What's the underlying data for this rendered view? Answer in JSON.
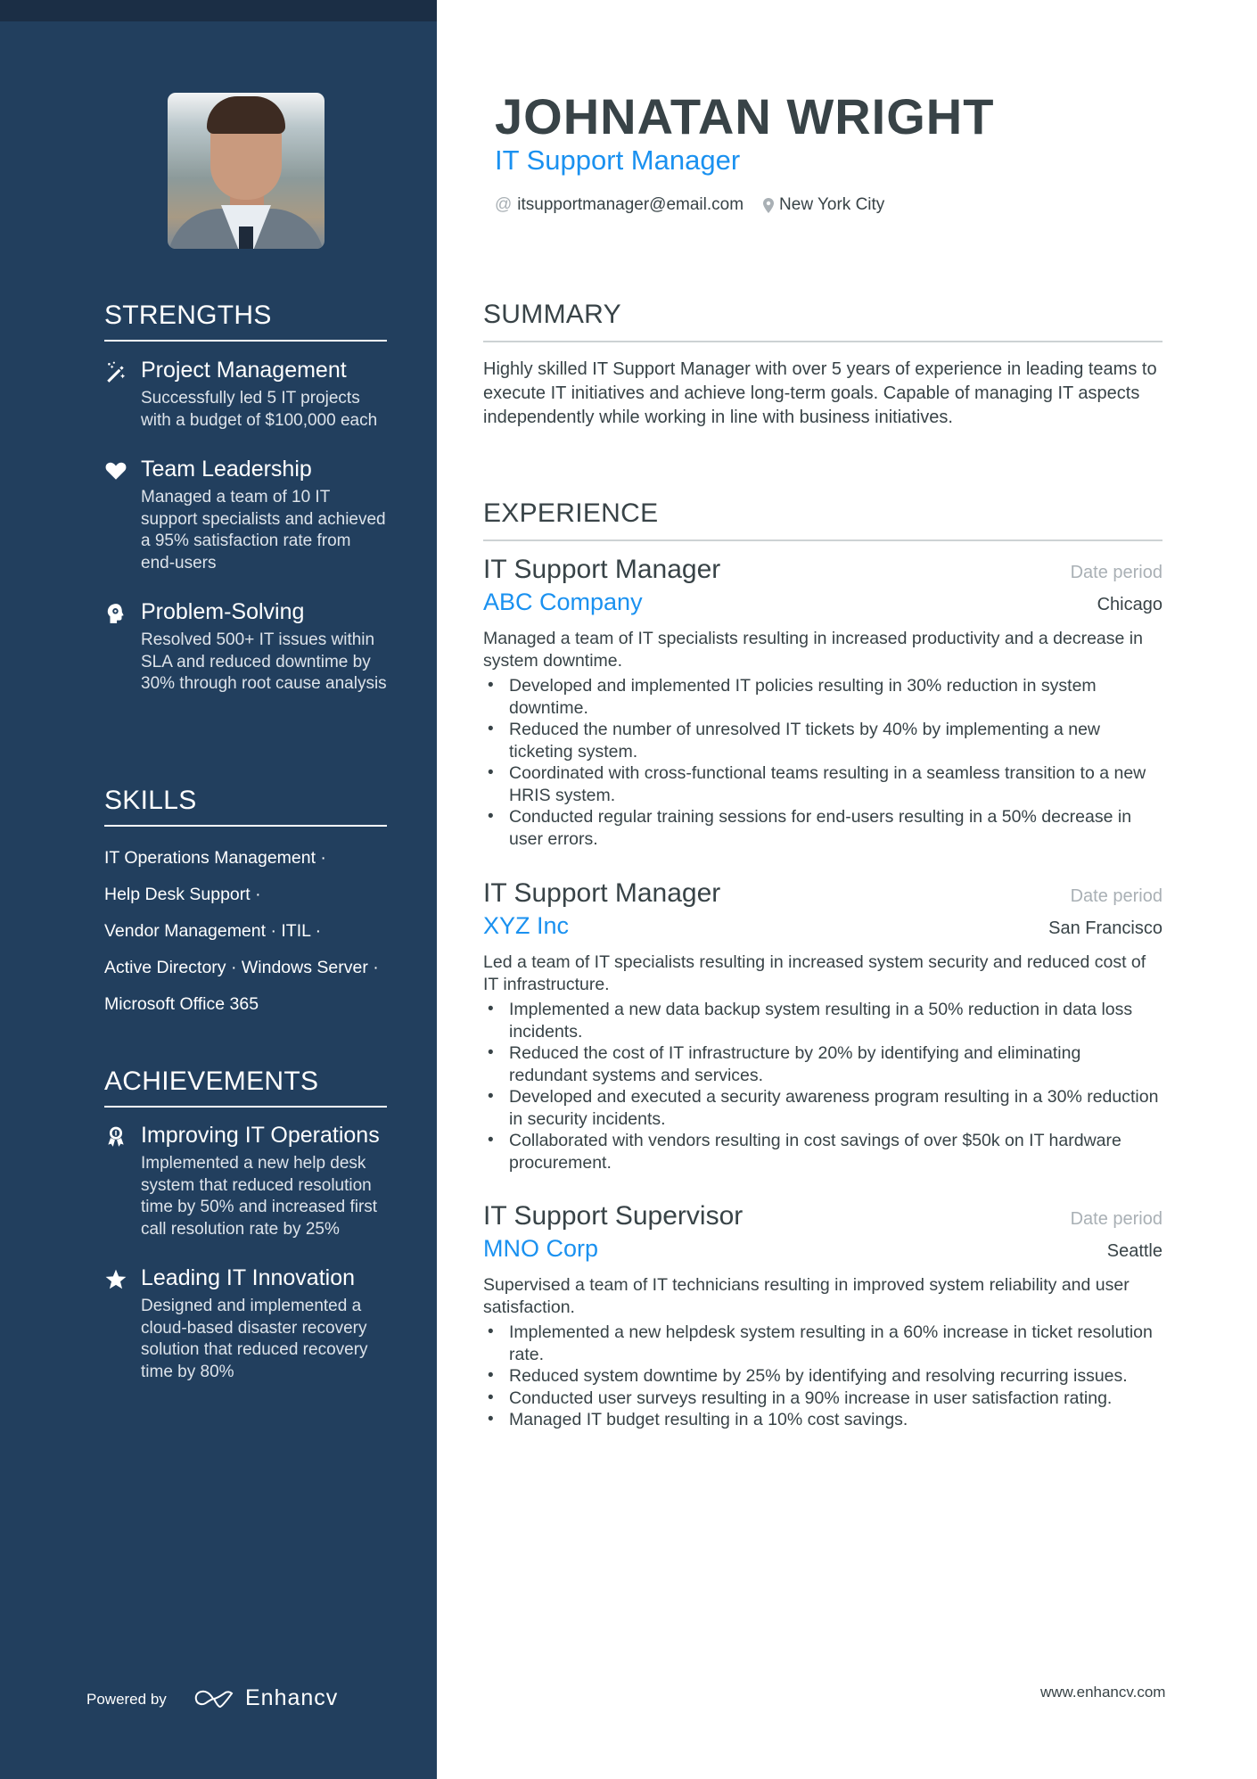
{
  "header": {
    "name": "JOHNATAN WRIGHT",
    "title": "IT Support Manager",
    "email": "itsupportmanager@email.com",
    "location": "New York City",
    "email_icon": "at-icon",
    "location_icon": "map-pin-icon"
  },
  "sidebar": {
    "strengths": {
      "heading": "STRENGTHS",
      "items": [
        {
          "icon": "magic-wand-icon",
          "title": "Project Management",
          "desc": "Successfully led 5 IT projects with a budget of $100,000 each"
        },
        {
          "icon": "heart-icon",
          "title": "Team Leadership",
          "desc": "Managed a team of 10 IT support specialists and achieved a 95% satisfaction rate from end-users"
        },
        {
          "icon": "brain-head-icon",
          "title": "Problem-Solving",
          "desc": "Resolved 500+ IT issues within SLA and reduced downtime by 30% through root cause analysis"
        }
      ]
    },
    "skills": {
      "heading": "SKILLS",
      "lines": [
        "IT Operations Management ·",
        "Help Desk Support ·",
        "Vendor Management · ITIL ·",
        "Active Directory · Windows Server ·",
        "Microsoft Office 365"
      ]
    },
    "achievements": {
      "heading": "ACHIEVEMENTS",
      "items": [
        {
          "icon": "award-ribbon-icon",
          "title": "Improving IT Operations",
          "desc": "Implemented a new help desk system that reduced resolution time by 50% and increased first call resolution rate by 25%"
        },
        {
          "icon": "star-icon",
          "title": "Leading IT Innovation",
          "desc": "Designed and implemented a cloud-based disaster recovery solution that reduced recovery time by 80%"
        }
      ]
    }
  },
  "summary": {
    "heading": "SUMMARY",
    "text": "Highly skilled IT Support Manager with over 5 years of experience in leading teams to execute IT initiatives and achieve long-term goals. Capable of managing IT aspects independently while working in line with business initiatives."
  },
  "experience": {
    "heading": "EXPERIENCE",
    "jobs": [
      {
        "title": "IT Support Manager",
        "date": "Date period",
        "company": "ABC Company",
        "location": "Chicago",
        "desc": "Managed a team of IT specialists resulting in increased productivity and a decrease in system downtime.",
        "bullets": [
          "Developed and implemented IT policies resulting in 30% reduction in system downtime.",
          "Reduced the number of unresolved IT tickets by 40% by implementing a new ticketing system.",
          "Coordinated with cross-functional teams resulting in a seamless transition to a new HRIS system.",
          "Conducted regular training sessions for end-users resulting in a 50% decrease in user errors."
        ]
      },
      {
        "title": "IT Support Manager",
        "date": "Date period",
        "company": "XYZ Inc",
        "location": "San Francisco",
        "desc": "Led a team of IT specialists resulting in increased system security and reduced cost of IT infrastructure.",
        "bullets": [
          "Implemented a new data backup system resulting in a 50% reduction in data loss incidents.",
          "Reduced the cost of IT infrastructure by 20% by identifying and eliminating redundant systems and services.",
          "Developed and executed a security awareness program resulting in a 30% reduction in security incidents.",
          "Collaborated with vendors resulting in cost savings of over $50k on IT hardware procurement."
        ]
      },
      {
        "title": "IT Support Supervisor",
        "date": "Date period",
        "company": "MNO Corp",
        "location": "Seattle",
        "desc": "Supervised a team of IT technicians resulting in improved system reliability and user satisfaction.",
        "bullets": [
          "Implemented a new helpdesk system resulting in a 60% increase in ticket resolution rate.",
          "Reduced system downtime by 25% by identifying and resolving recurring issues.",
          "Conducted user surveys resulting in a 90% increase in user satisfaction rating.",
          "Managed IT budget resulting in a 10% cost savings."
        ]
      }
    ]
  },
  "footer": {
    "powered_by": "Powered by",
    "brand": "Enhancv",
    "url": "www.enhancv.com"
  },
  "colors": {
    "sidebar_bg": "#223F5E",
    "sidebar_strip": "#1B2E45",
    "accent": "#1A91F0",
    "text": "#384347",
    "muted": "#A9B0B5"
  }
}
